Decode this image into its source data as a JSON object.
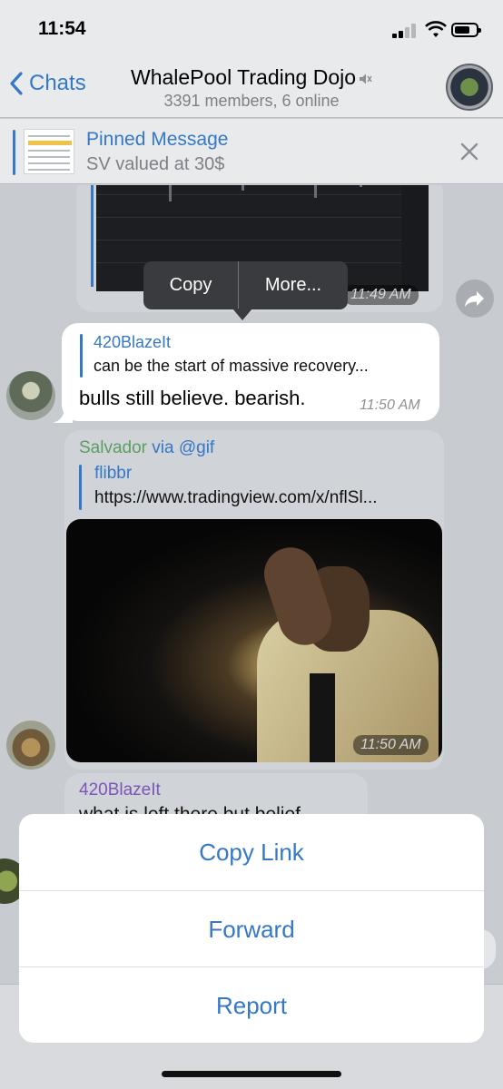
{
  "status": {
    "time": "11:54"
  },
  "nav": {
    "back_label": "Chats",
    "title": "WhalePool Trading Dojo",
    "subtitle": "3391 members, 6 online"
  },
  "pinned": {
    "title": "Pinned Message",
    "text": "SV valued at 30$"
  },
  "messages": {
    "chart_time": "11:49 AM",
    "reply": {
      "quote_name": "420BlazeIt",
      "quote_text": "can be the start of massive recovery...",
      "text": "bulls still believe. bearish.",
      "time": "11:50 AM"
    },
    "gif": {
      "sender": "Salvador",
      "via": "via @gif",
      "link_name": "flibbr",
      "link_url": "https://www.tradingview.com/x/nflSl...",
      "time": "11:50 AM"
    },
    "last": {
      "sender": "420BlazeIt",
      "text": "what is left there but belief"
    }
  },
  "context_menu": {
    "copy": "Copy",
    "more": "More..."
  },
  "action_sheet": {
    "copy_link": "Copy Link",
    "forward": "Forward",
    "report": "Report"
  },
  "colors": {
    "accent": "#3478c6",
    "sender_green": "#5a9e62",
    "sender_purple": "#7b56b8"
  }
}
